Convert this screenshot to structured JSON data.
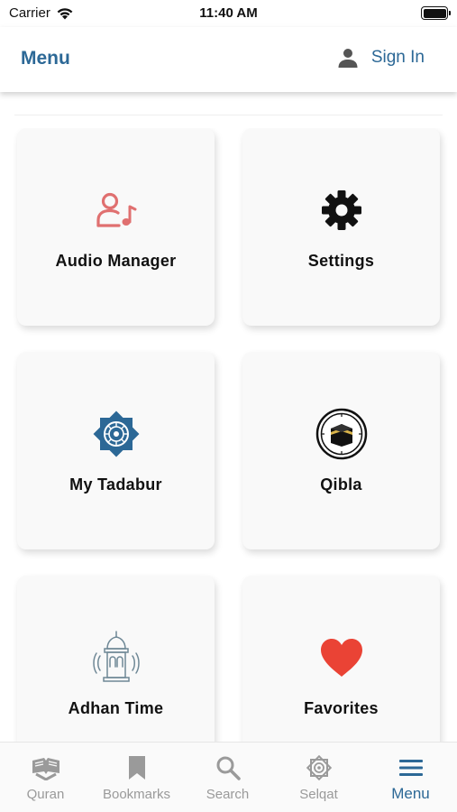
{
  "status_bar": {
    "carrier": "Carrier",
    "time": "11:40 AM"
  },
  "header": {
    "title": "Menu",
    "sign_in": "Sign In"
  },
  "colors": {
    "accent": "#2c6896",
    "audio_icon": "#e07070",
    "favorite_icon": "#ea4335",
    "inactive_tab": "#9a9a9a"
  },
  "cards": [
    {
      "label": "Audio Manager",
      "icon": "person-music-icon"
    },
    {
      "label": "Settings",
      "icon": "gear-icon"
    },
    {
      "label": "My Tadabur",
      "icon": "islamic-star-icon"
    },
    {
      "label": "Qibla",
      "icon": "kaaba-compass-icon"
    },
    {
      "label": "Adhan Time",
      "icon": "minaret-icon"
    },
    {
      "label": "Favorites",
      "icon": "heart-icon"
    }
  ],
  "tabs": [
    {
      "label": "Quran",
      "icon": "open-book-icon"
    },
    {
      "label": "Bookmarks",
      "icon": "bookmark-icon"
    },
    {
      "label": "Search",
      "icon": "search-icon"
    },
    {
      "label": "Selqat",
      "icon": "ornament-star-icon"
    },
    {
      "label": "Menu",
      "icon": "hamburger-icon",
      "active": true
    }
  ]
}
